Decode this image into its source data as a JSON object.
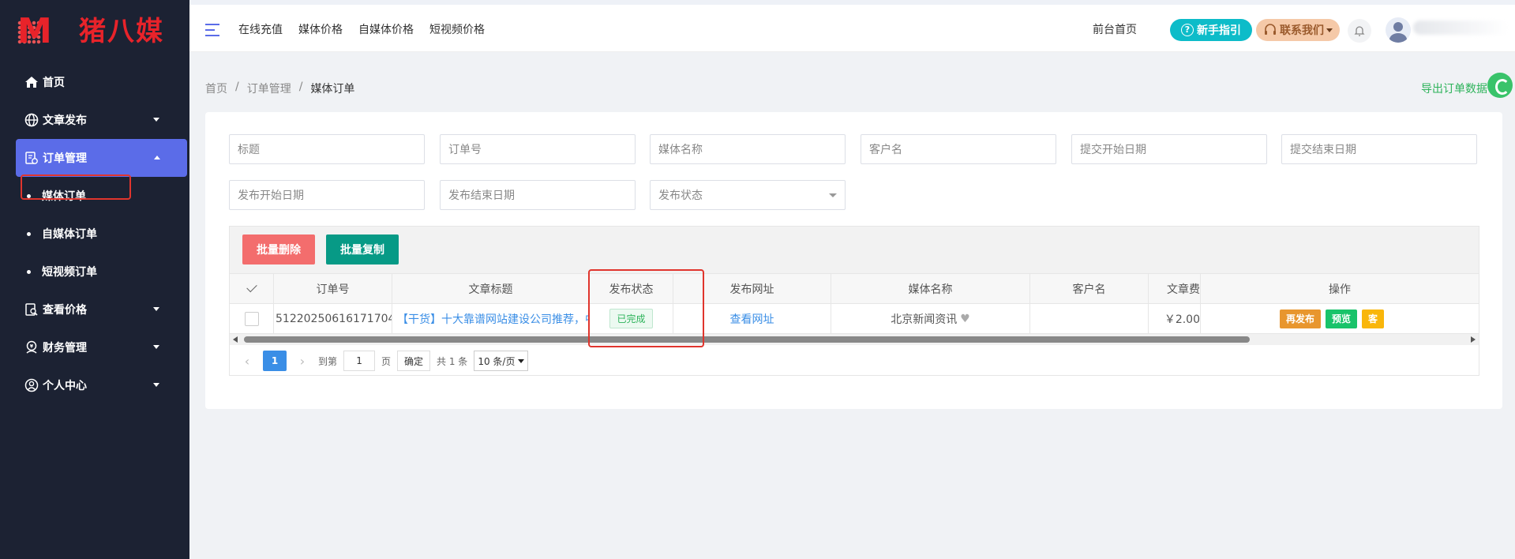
{
  "brand": {
    "logo_letter": "M",
    "name": "猪八媒"
  },
  "sidebar": {
    "items": [
      {
        "label": "首页"
      },
      {
        "label": "文章发布"
      },
      {
        "label": "订单管理"
      },
      {
        "label": "媒体订单"
      },
      {
        "label": "自媒体订单"
      },
      {
        "label": "短视频订单"
      },
      {
        "label": "查看价格"
      },
      {
        "label": "财务管理"
      },
      {
        "label": "个人中心"
      }
    ]
  },
  "header": {
    "nav": [
      "在线充值",
      "媒体价格",
      "自媒体价格",
      "短视频价格"
    ],
    "front_link": "前台首页",
    "guide_button": "新手指引",
    "guide_icon_glyph": "?",
    "contact_button": "联系我们"
  },
  "breadcrumb": [
    "首页",
    "订单管理",
    "媒体订单"
  ],
  "breadcrumb_sep": "/",
  "export_link": "导出订单数据",
  "filters": {
    "title": "标题",
    "order_no": "订单号",
    "media_name": "媒体名称",
    "customer": "客户名",
    "submit_start": "提交开始日期",
    "submit_end": "提交结束日期",
    "publish_start": "发布开始日期",
    "publish_end": "发布结束日期",
    "publish_status": "发布状态"
  },
  "toolbar": {
    "batch_delete": "批量删除",
    "batch_copy": "批量复制"
  },
  "table": {
    "columns": [
      "订单号",
      "文章标题",
      "发布状态",
      "发布网址",
      "媒体名称",
      "客户名",
      "文章费",
      "操作"
    ],
    "rows": [
      {
        "order_no": "512202506161717042...",
        "title": "【干货】十大靠谱网站建设公司推荐，中...",
        "status": "已完成",
        "url": "查看网址",
        "media": "北京新闻资讯",
        "customer": "",
        "fee": "￥2.00",
        "ops": [
          "再发布",
          "预览",
          "客"
        ]
      }
    ]
  },
  "pager": {
    "current": "1",
    "goto": "到第",
    "page_input": "1",
    "page_unit": "页",
    "confirm": "确定",
    "total": "共 1 条",
    "page_size": "10 条/页"
  }
}
